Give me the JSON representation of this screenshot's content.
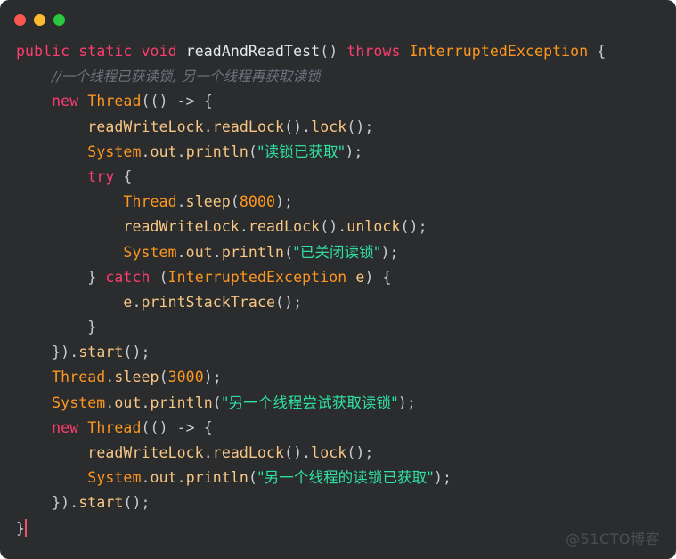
{
  "window": {
    "background_color": "#2a2c2e",
    "traffic_lights": [
      {
        "name": "close",
        "color": "#f9584f"
      },
      {
        "name": "minimize",
        "color": "#fbbc2e"
      },
      {
        "name": "maximize",
        "color": "#2ac841"
      }
    ]
  },
  "theme": {
    "keyword_color": "#fc3d70",
    "class_color": "#fd9720",
    "number_color": "#fd9720",
    "identifier_color": "#f9c784",
    "string_color": "#2fe0a4",
    "comment_color": "#6d737d",
    "plain_color": "#c8cdd4",
    "caret_color": "#e8556d",
    "watermark_color": "#4b4e53"
  },
  "code": {
    "language": "java",
    "lines": [
      {
        "n": 1,
        "indent": 0,
        "tokens": [
          {
            "t": "kw",
            "v": "public"
          },
          {
            "t": "plain",
            "v": " "
          },
          {
            "t": "kw",
            "v": "static"
          },
          {
            "t": "plain",
            "v": " "
          },
          {
            "t": "kw",
            "v": "void"
          },
          {
            "t": "plain",
            "v": " "
          },
          {
            "t": "plain",
            "v": "readAndReadTest"
          },
          {
            "t": "punct",
            "v": "() "
          },
          {
            "t": "kw",
            "v": "throws"
          },
          {
            "t": "plain",
            "v": " "
          },
          {
            "t": "cls",
            "v": "InterruptedException"
          },
          {
            "t": "punct",
            "v": " {"
          }
        ]
      },
      {
        "n": 2,
        "indent": 1,
        "tokens": [
          {
            "t": "cmt",
            "v": "//一个线程已获读锁, 另一个线程再获取读锁"
          }
        ]
      },
      {
        "n": 3,
        "indent": 1,
        "tokens": [
          {
            "t": "kw",
            "v": "new"
          },
          {
            "t": "plain",
            "v": " "
          },
          {
            "t": "cls",
            "v": "Thread"
          },
          {
            "t": "punct",
            "v": "(() -> {"
          }
        ]
      },
      {
        "n": 4,
        "indent": 2,
        "tokens": [
          {
            "t": "id",
            "v": "readWriteLock"
          },
          {
            "t": "punct",
            "v": "."
          },
          {
            "t": "id",
            "v": "readLock"
          },
          {
            "t": "punct",
            "v": "()."
          },
          {
            "t": "id",
            "v": "lock"
          },
          {
            "t": "punct",
            "v": "();"
          }
        ]
      },
      {
        "n": 5,
        "indent": 2,
        "tokens": [
          {
            "t": "cls",
            "v": "System"
          },
          {
            "t": "punct",
            "v": "."
          },
          {
            "t": "id",
            "v": "out"
          },
          {
            "t": "punct",
            "v": "."
          },
          {
            "t": "id",
            "v": "println"
          },
          {
            "t": "punct",
            "v": "("
          },
          {
            "t": "str",
            "v": "\"读锁已获取\""
          },
          {
            "t": "punct",
            "v": ");"
          }
        ]
      },
      {
        "n": 6,
        "indent": 2,
        "tokens": [
          {
            "t": "kw",
            "v": "try"
          },
          {
            "t": "punct",
            "v": " {"
          }
        ]
      },
      {
        "n": 7,
        "indent": 3,
        "tokens": [
          {
            "t": "cls",
            "v": "Thread"
          },
          {
            "t": "punct",
            "v": "."
          },
          {
            "t": "id",
            "v": "sleep"
          },
          {
            "t": "punct",
            "v": "("
          },
          {
            "t": "num",
            "v": "8000"
          },
          {
            "t": "punct",
            "v": ");"
          }
        ]
      },
      {
        "n": 8,
        "indent": 3,
        "tokens": [
          {
            "t": "id",
            "v": "readWriteLock"
          },
          {
            "t": "punct",
            "v": "."
          },
          {
            "t": "id",
            "v": "readLock"
          },
          {
            "t": "punct",
            "v": "()."
          },
          {
            "t": "id",
            "v": "unlock"
          },
          {
            "t": "punct",
            "v": "();"
          }
        ]
      },
      {
        "n": 9,
        "indent": 3,
        "tokens": [
          {
            "t": "cls",
            "v": "System"
          },
          {
            "t": "punct",
            "v": "."
          },
          {
            "t": "id",
            "v": "out"
          },
          {
            "t": "punct",
            "v": "."
          },
          {
            "t": "id",
            "v": "println"
          },
          {
            "t": "punct",
            "v": "("
          },
          {
            "t": "str",
            "v": "\"已关闭读锁\""
          },
          {
            "t": "punct",
            "v": ");"
          }
        ]
      },
      {
        "n": 10,
        "indent": 2,
        "tokens": [
          {
            "t": "punct",
            "v": "} "
          },
          {
            "t": "kw",
            "v": "catch"
          },
          {
            "t": "punct",
            "v": " ("
          },
          {
            "t": "cls",
            "v": "InterruptedException"
          },
          {
            "t": "punct",
            "v": " "
          },
          {
            "t": "id",
            "v": "e"
          },
          {
            "t": "punct",
            "v": ") {"
          }
        ]
      },
      {
        "n": 11,
        "indent": 3,
        "tokens": [
          {
            "t": "id",
            "v": "e"
          },
          {
            "t": "punct",
            "v": "."
          },
          {
            "t": "id",
            "v": "printStackTrace"
          },
          {
            "t": "punct",
            "v": "();"
          }
        ]
      },
      {
        "n": 12,
        "indent": 2,
        "tokens": [
          {
            "t": "punct",
            "v": "}"
          }
        ]
      },
      {
        "n": 13,
        "indent": 1,
        "tokens": [
          {
            "t": "punct",
            "v": "})."
          },
          {
            "t": "id",
            "v": "start"
          },
          {
            "t": "punct",
            "v": "();"
          }
        ]
      },
      {
        "n": 14,
        "indent": 1,
        "tokens": [
          {
            "t": "cls",
            "v": "Thread"
          },
          {
            "t": "punct",
            "v": "."
          },
          {
            "t": "id",
            "v": "sleep"
          },
          {
            "t": "punct",
            "v": "("
          },
          {
            "t": "num",
            "v": "3000"
          },
          {
            "t": "punct",
            "v": ");"
          }
        ]
      },
      {
        "n": 15,
        "indent": 1,
        "tokens": [
          {
            "t": "cls",
            "v": "System"
          },
          {
            "t": "punct",
            "v": "."
          },
          {
            "t": "id",
            "v": "out"
          },
          {
            "t": "punct",
            "v": "."
          },
          {
            "t": "id",
            "v": "println"
          },
          {
            "t": "punct",
            "v": "("
          },
          {
            "t": "str",
            "v": "\"另一个线程尝试获取读锁\""
          },
          {
            "t": "punct",
            "v": ");"
          }
        ]
      },
      {
        "n": 16,
        "indent": 1,
        "tokens": [
          {
            "t": "kw",
            "v": "new"
          },
          {
            "t": "plain",
            "v": " "
          },
          {
            "t": "cls",
            "v": "Thread"
          },
          {
            "t": "punct",
            "v": "(() -> {"
          }
        ]
      },
      {
        "n": 17,
        "indent": 2,
        "tokens": [
          {
            "t": "id",
            "v": "readWriteLock"
          },
          {
            "t": "punct",
            "v": "."
          },
          {
            "t": "id",
            "v": "readLock"
          },
          {
            "t": "punct",
            "v": "()."
          },
          {
            "t": "id",
            "v": "lock"
          },
          {
            "t": "punct",
            "v": "();"
          }
        ]
      },
      {
        "n": 18,
        "indent": 2,
        "tokens": [
          {
            "t": "cls",
            "v": "System"
          },
          {
            "t": "punct",
            "v": "."
          },
          {
            "t": "id",
            "v": "out"
          },
          {
            "t": "punct",
            "v": "."
          },
          {
            "t": "id",
            "v": "println"
          },
          {
            "t": "punct",
            "v": "("
          },
          {
            "t": "str",
            "v": "\"另一个线程的读锁已获取\""
          },
          {
            "t": "punct",
            "v": ");"
          }
        ]
      },
      {
        "n": 19,
        "indent": 1,
        "tokens": [
          {
            "t": "punct",
            "v": "})."
          },
          {
            "t": "id",
            "v": "start"
          },
          {
            "t": "punct",
            "v": "();"
          }
        ]
      },
      {
        "n": 20,
        "indent": 0,
        "tokens": [
          {
            "t": "punct",
            "v": "}"
          },
          {
            "t": "caret",
            "v": ""
          }
        ]
      }
    ]
  },
  "watermark": {
    "text": "@51CTO博客"
  }
}
